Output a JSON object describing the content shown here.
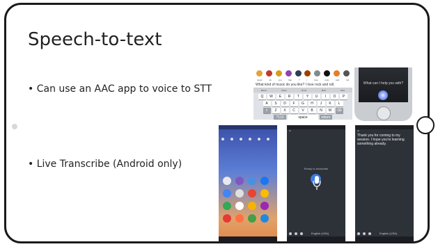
{
  "slide": {
    "title": "Speech-to-text",
    "bullets": [
      "• Can use an AAC app to voice to STT",
      "• Live Transcribe (Android only)"
    ]
  },
  "aac_image": {
    "labels": [
      "music",
      "do",
      "you",
      "like",
      "?",
      "I",
      "love",
      "rock",
      "and",
      "roll"
    ],
    "message": "What kind of music do you like? I love rock and roll.",
    "suggestions": [
      "Bored",
      "Deep",
      "Done",
      "Mad",
      "Nice"
    ],
    "keyboard_rows": [
      [
        "Q",
        "W",
        "E",
        "R",
        "T",
        "Y",
        "U",
        "I",
        "O",
        "P"
      ],
      [
        "A",
        "S",
        "D",
        "F",
        "G",
        "H",
        "J",
        "K",
        "L"
      ],
      [
        "Z",
        "X",
        "C",
        "V",
        "B",
        "N",
        "M"
      ]
    ],
    "bottom_keys": [
      "?123",
      "space",
      "return"
    ],
    "symbol_colors": [
      "#e0a43a",
      "#c0392b",
      "#d4a017",
      "#8e44ad",
      "#2c3e50",
      "#a04000",
      "#7f8c8d",
      "#111111",
      "#e67e22",
      "#555555"
    ]
  },
  "siri_image": {
    "prompt": "What can I help you with?"
  },
  "live_transcribe": {
    "ready_text": "Ready to transcribe",
    "transcript": "Thank you for coming to my session. I hope you're learning something already.",
    "language": "English (USA)",
    "close_glyph": "×",
    "accent": "#3b7de0"
  },
  "home_apps_colors": [
    "#e8e8f0",
    "#7e57c2",
    "#4a90e2",
    "#1877f2",
    "#4285f4",
    "#e0e0e0",
    "#ea4335",
    "#fbbc05",
    "#34a853",
    "#ffffff",
    "#f4b400",
    "#9c27b0",
    "#e53935",
    "#ff7043",
    "#43a047",
    "#1e88e5"
  ]
}
